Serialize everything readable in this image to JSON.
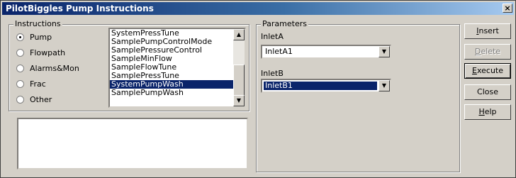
{
  "window": {
    "title": "PilotBiggles Pump Instructions",
    "close_label": "×"
  },
  "instructions": {
    "legend": "Instructions",
    "radios": [
      {
        "label": "Pump",
        "checked": true
      },
      {
        "label": "Flowpath",
        "checked": false
      },
      {
        "label": "Alarms&Mon",
        "checked": false
      },
      {
        "label": "Frac",
        "checked": false
      },
      {
        "label": "Other",
        "checked": false
      }
    ],
    "list": [
      "SystemPressTune",
      "SamplePumpControlMode",
      "SamplePressureControl",
      "SampleMinFlow",
      "SampleFlowTune",
      "SamplePressTune",
      "SystemPumpWash",
      "SamplePumpWash"
    ],
    "selected_index": 6
  },
  "parameters": {
    "legend": "Parameters",
    "inlet_a": {
      "label": "InletA",
      "value": "InletA1"
    },
    "inlet_b": {
      "label": "InletB",
      "value": "InletB1"
    }
  },
  "buttons": {
    "insert": {
      "pre": "",
      "mn": "I",
      "post": "nsert"
    },
    "delete": {
      "pre": "",
      "mn": "D",
      "post": "elete"
    },
    "execute": {
      "pre": "",
      "mn": "E",
      "post": "xecute"
    },
    "close": {
      "label": "Close"
    },
    "help": {
      "pre": "",
      "mn": "H",
      "post": "elp"
    }
  }
}
